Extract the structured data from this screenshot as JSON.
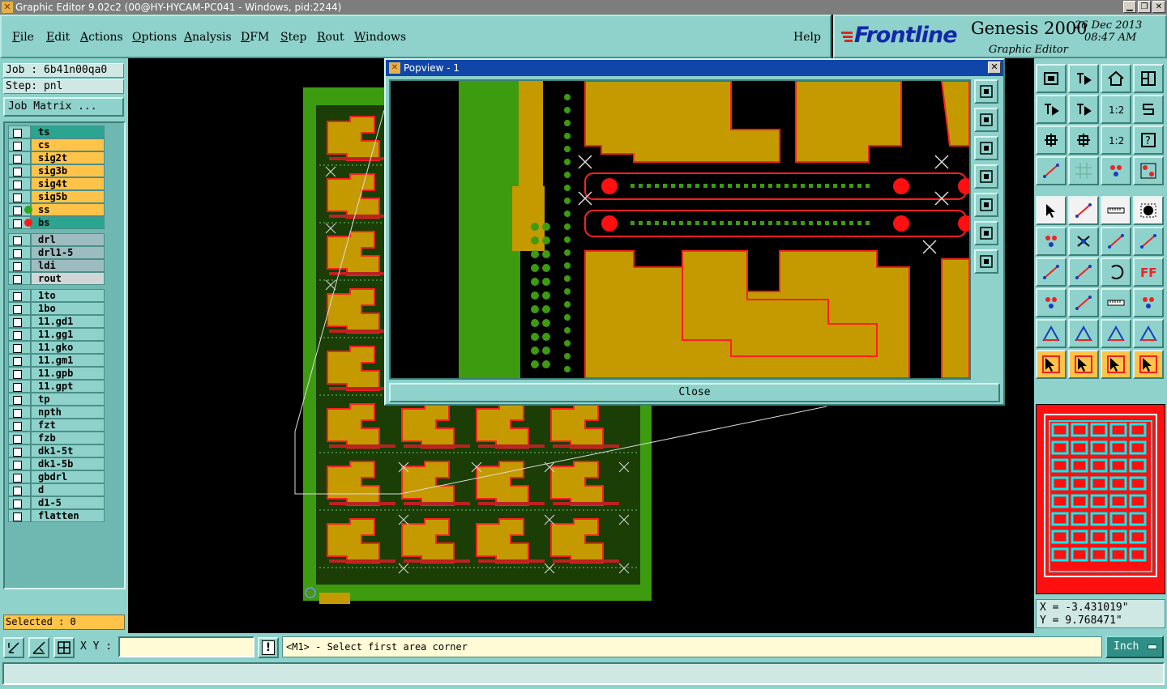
{
  "window": {
    "title": "Graphic Editor 9.02c2 (00@HY-HYCAM-PC041 - Windows, pid:2244)"
  },
  "menu": {
    "items": [
      "File",
      "Edit",
      "Actions",
      "Options",
      "Analysis",
      "DFM",
      "Step",
      "Rout",
      "Windows"
    ],
    "help": "Help"
  },
  "brand": {
    "logo": "Frontline",
    "product": "Genesis 2000",
    "subtitle": "Graphic Editor",
    "date": "26 Dec 2013",
    "time": "08:47 AM"
  },
  "job": {
    "job_label": "Job : 6b41n00qa0",
    "step_label": "Step: pnl",
    "matrix_button": "Job Matrix ..."
  },
  "layers": {
    "board": [
      "ts",
      "cs",
      "sig2t",
      "sig3b",
      "sig4t",
      "sig5b",
      "ss",
      "bs"
    ],
    "drill": [
      "drl",
      "drl1-5",
      "ldi",
      "rout"
    ],
    "misc": [
      "1to",
      "1bo",
      "11.gd1",
      "11.gg1",
      "11.gko",
      "11.gm1",
      "11.gpb",
      "11.gpt",
      "tp",
      "npth",
      "fzt",
      "fzb",
      "dk1-5t",
      "dk1-5b",
      "gbdrl",
      "d",
      "d1-5",
      "flatten"
    ]
  },
  "selected": "Selected : 0",
  "popview": {
    "title": "Popview - 1",
    "close_label": "Close"
  },
  "coords": {
    "x": "X = -3.431019\"",
    "y": "Y = 9.768471\""
  },
  "bottom": {
    "xy_label": "X Y :",
    "xy_value": "",
    "prompt": "<M1> - Select first area corner",
    "units": "Inch"
  },
  "colors": {
    "copper": "#c49a00",
    "edge": "#ff2020",
    "board": "#3d9b10",
    "panel": "#8ed2cb",
    "highlight": "#ffc34a",
    "layer_active": "#2ba58f"
  }
}
